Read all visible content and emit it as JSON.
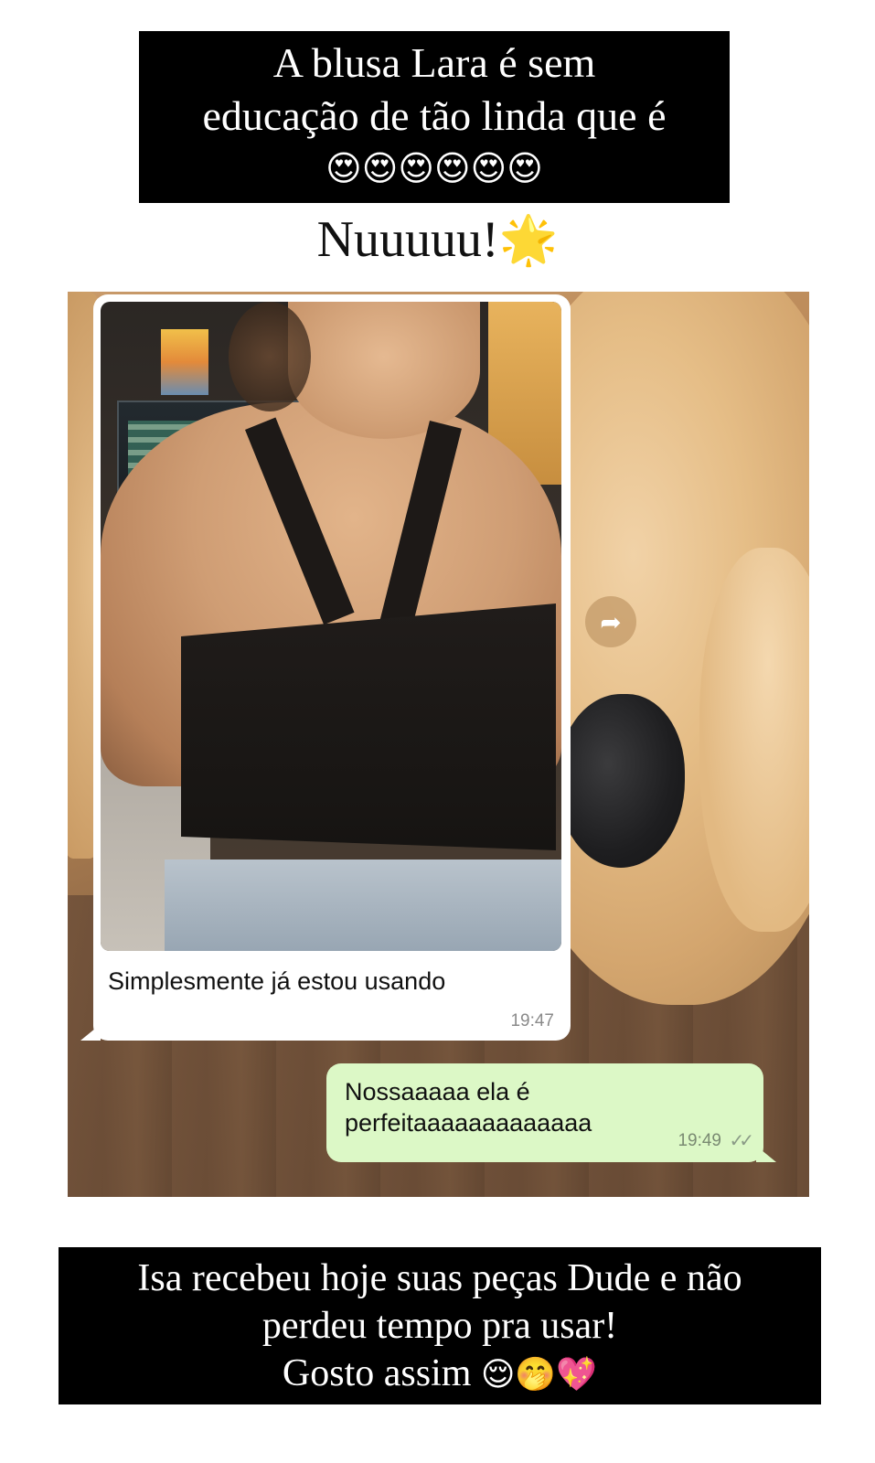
{
  "top_caption": {
    "line1": "A blusa Lara é sem",
    "line2": "educação de tão linda que é",
    "emojis": "😍😍😍😍😍😍"
  },
  "headline": {
    "text": "Nuuuuu!",
    "emoji": "🌟"
  },
  "chat": {
    "incoming": {
      "text": "Simplesmente já estou usando",
      "time": "19:47"
    },
    "outgoing": {
      "line1": "Nossaaaaa ela é",
      "line2": "perfeitaaaaaaaaaaaaa",
      "time": "19:49",
      "status_icon": "double-check-icon",
      "ticks": "✓✓"
    },
    "forward_icon": "forward-icon",
    "forward_glyph": "➦"
  },
  "bottom_caption": {
    "line1": "Isa recebeu hoje suas peças Dude e não",
    "line2": "perdeu tempo pra usar!",
    "line3": "Gosto assim",
    "emojis": "😌🤭💖"
  }
}
